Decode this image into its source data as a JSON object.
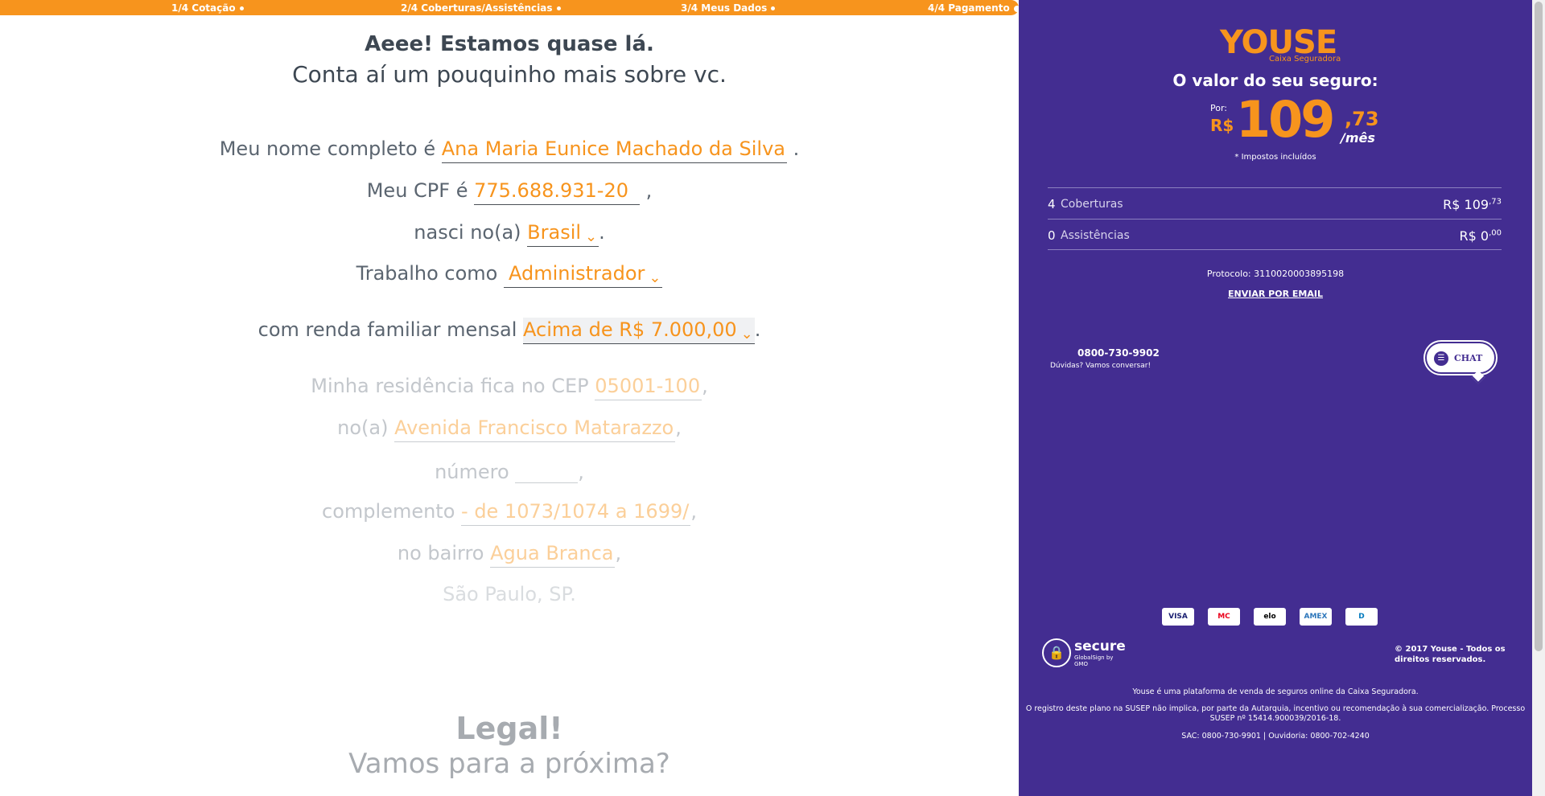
{
  "progress": {
    "steps": [
      "1/4 Cotação",
      "2/4 Coberturas/Assistências",
      "3/4 Meus Dados",
      "4/4 Pagamento"
    ],
    "color": "#f7941d"
  },
  "form": {
    "heading1": "Aeee! Estamos quase lá.",
    "heading2": "Conta aí um pouquinho mais sobre vc.",
    "name_prefix": "Meu nome completo é",
    "name_value": "Ana Maria Eunice Machado da Silva",
    "name_suffix": ".",
    "cpf_prefix": "Meu CPF é",
    "cpf_value": "775.688.931-20",
    "cpf_suffix": ",",
    "birth_prefix": "nasci no(a)",
    "birth_value": "Brasil",
    "birth_suffix": ".",
    "job_prefix": "Trabalho como",
    "job_value": "Administrador",
    "income_prefix": "com renda familiar mensal",
    "income_value": "Acima de R$ 7.000,00",
    "income_suffix": ".",
    "cep_prefix": "Minha residência fica no CEP",
    "cep_value": "05001-100",
    "cep_suffix": ",",
    "street_prefix": "no(a)",
    "street_value": "Avenida Francisco Matarazzo",
    "street_suffix": ",",
    "number_prefix": "número",
    "number_value": "",
    "number_suffix": ",",
    "complement_prefix": "complemento",
    "complement_value": "- de 1073/1074 a 1699/",
    "complement_suffix": ",",
    "district_prefix": "no bairro",
    "district_value": "Agua Branca",
    "district_suffix": ",",
    "city_value": "São Paulo",
    "city_sep": ",",
    "state_value": "SP",
    "state_suffix": ".",
    "chevron": "⌄",
    "legal1": "Legal!",
    "legal2": "Vamos para a próxima?"
  },
  "panel": {
    "logo": "YOUSE",
    "logo_sub": "Caixa Seguradora",
    "price_title": "O valor do seu seguro:",
    "por_label": "Por:",
    "currency": "R$",
    "price_int": "109",
    "price_dec": ",73",
    "per_month": "/mês",
    "taxes": "* Impostos incluídos",
    "coverages_count": "4",
    "coverages_label": "Coberturas",
    "coverages_value": "R$ 109",
    "coverages_cents": ",73",
    "assist_count": "0",
    "assist_label": "Assistências",
    "assist_value": "R$ 0",
    "assist_cents": ",00",
    "protocol": "Protocolo: 3110020003895198",
    "email_link": "ENVIAR POR EMAIL",
    "phone": "0800-730-9902",
    "phone_sub": "Dúvidas? Vamos conversar!",
    "chat_label": "CHAT",
    "cards": [
      "VISA",
      "MC",
      "elo",
      "AMEX",
      "D"
    ],
    "secure_title": "secure",
    "secure_sub": "GlobalSign by GMO",
    "copyright": "© 2017 Youse - Todos os direitos reservados.",
    "footer1": "Youse é uma plataforma de venda de seguros online da Caixa Seguradora.",
    "footer2": "O registro deste plano na SUSEP não implica, por parte da Autarquia, incentivo ou recomendação à sua comercialização. Processo SUSEP nº 15414.900039/2016-18.",
    "footer3": "SAC: 0800-730-9901 | Ouvidoria: 0800-702-4240",
    "bg_color": "#432d91",
    "accent": "#f7941d"
  }
}
